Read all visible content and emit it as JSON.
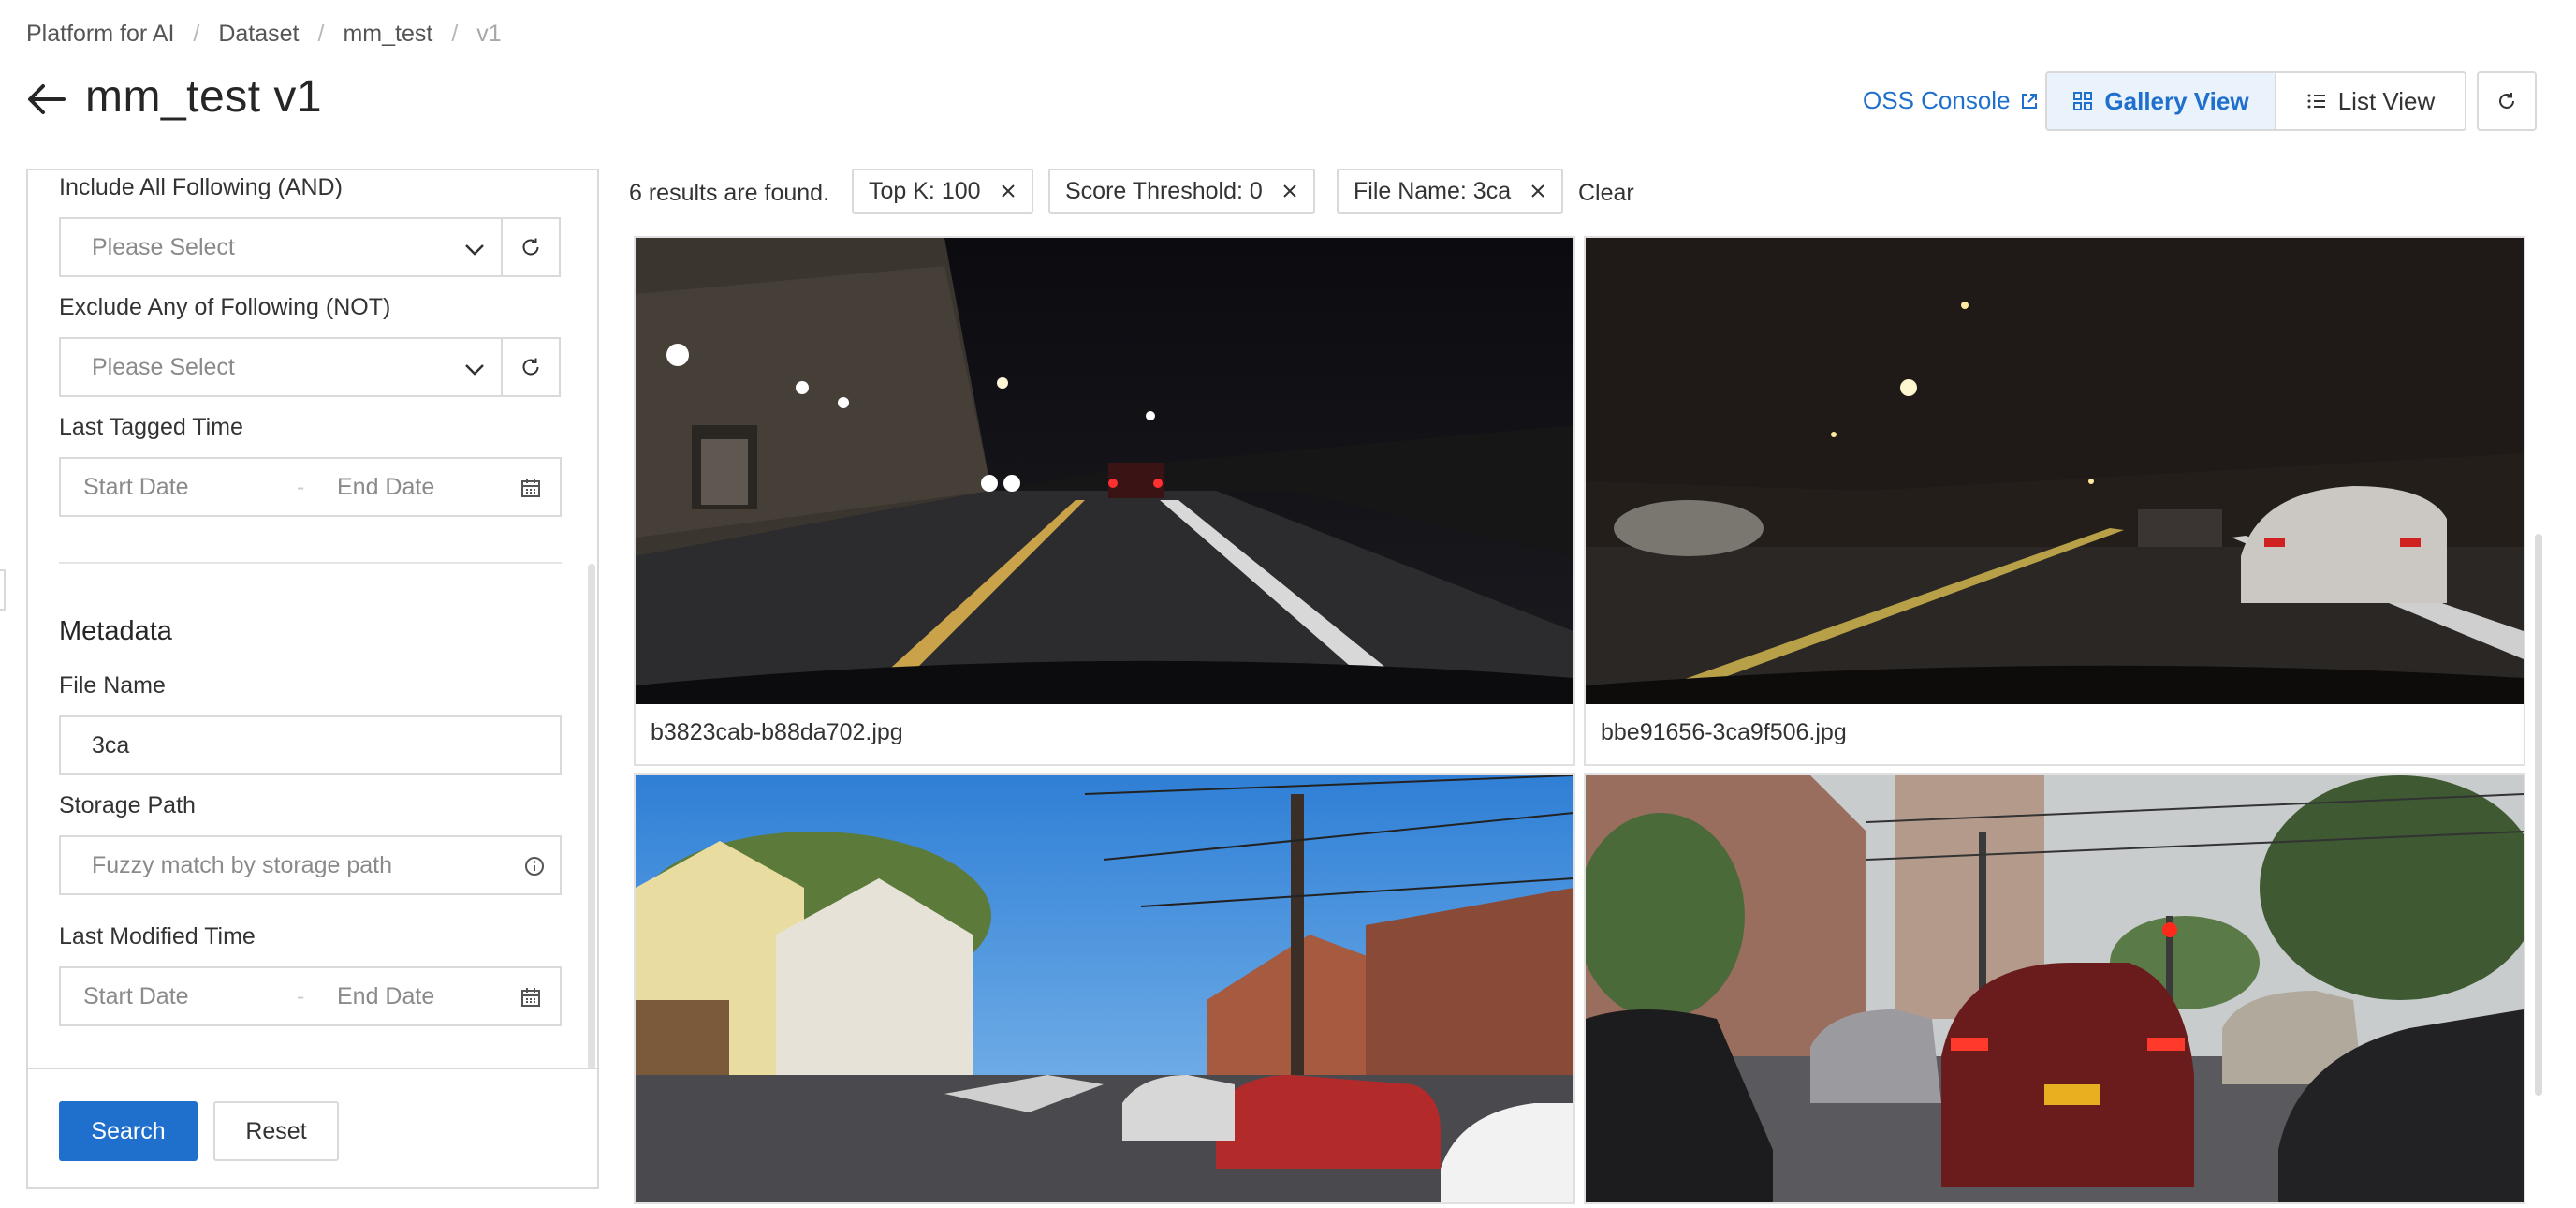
{
  "breadcrumb": {
    "items": [
      "Platform for AI",
      "Dataset",
      "mm_test"
    ],
    "current": "v1"
  },
  "header": {
    "title": "mm_test v1",
    "oss_console": "OSS Console",
    "gallery_view": "Gallery View",
    "list_view": "List View"
  },
  "filters": {
    "include_label": "Include All Following (AND)",
    "include_placeholder": "Please Select",
    "exclude_label": "Exclude Any of Following (NOT)",
    "exclude_placeholder": "Please Select",
    "last_tagged_label": "Last Tagged Time",
    "last_tagged_start": "Start Date",
    "last_tagged_end": "End Date",
    "metadata_title": "Metadata",
    "file_name_label": "File Name",
    "file_name_value": "3ca",
    "storage_path_label": "Storage Path",
    "storage_path_placeholder": "Fuzzy match by storage path",
    "last_modified_label": "Last Modified Time",
    "last_modified_start": "Start Date",
    "last_modified_end": "End Date",
    "date_separator": "-",
    "search_button": "Search",
    "reset_button": "Reset"
  },
  "results": {
    "count_text": "6 results are found.",
    "tags": [
      "Top K: 100",
      "Score Threshold: 0",
      "File Name: 3ca"
    ],
    "clear": "Clear"
  },
  "gallery": {
    "items": [
      {
        "caption": "b3823cab-b88da702.jpg",
        "scene": "night street with buildings and headlights"
      },
      {
        "caption": "bbe91656-3ca9f506.jpg",
        "scene": "dark street with parked cars"
      },
      {
        "caption": "",
        "scene": "sunny residential street with houses and power lines"
      },
      {
        "caption": "",
        "scene": "overcast street with traffic and red SUV"
      }
    ]
  },
  "colors": {
    "accent": "#1f6fcc",
    "border": "#d9d9d9",
    "active_bg": "#eaf2fc"
  }
}
